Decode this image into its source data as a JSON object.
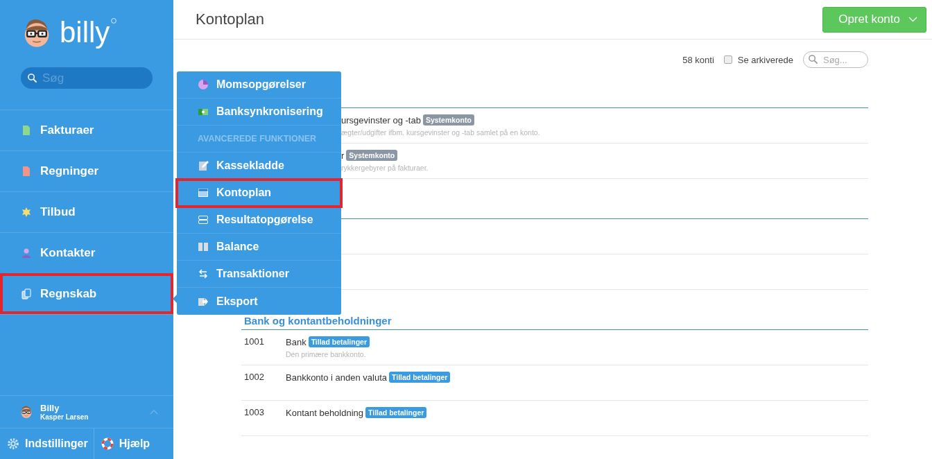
{
  "sidebar": {
    "logo": "billy",
    "search": {
      "placeholder": "Søg"
    },
    "nav": [
      {
        "label": "Fakturaer",
        "kind": "invoice",
        "highlighted": false
      },
      {
        "label": "Regninger",
        "kind": "bill",
        "highlighted": false
      },
      {
        "label": "Tilbud",
        "kind": "star",
        "highlighted": false
      },
      {
        "label": "Kontakter",
        "kind": "person",
        "highlighted": false
      },
      {
        "label": "Regnskab",
        "kind": "pages",
        "highlighted": true
      }
    ],
    "user": {
      "name": "Billy",
      "company": "Kasper Larsen"
    },
    "footer": [
      {
        "label": "Indstillinger",
        "kind": "settings"
      },
      {
        "label": "Hjælp",
        "kind": "help"
      }
    ]
  },
  "header": {
    "title": "Kontoplan",
    "button": "Opret konto"
  },
  "toolbar": {
    "count": "58 konti",
    "archived": {
      "label": "Se arkiverede",
      "checked": false
    },
    "search": {
      "placeholder": "Søg..."
    }
  },
  "popup": {
    "items": [
      {
        "kind": "pie",
        "label": "Momsopgørelser",
        "highlighted": false
      },
      {
        "kind": "money",
        "label": "Banksynkronisering",
        "highlighted": false
      },
      {
        "kind": "header",
        "label": "AVANCEREDE FUNKTIONER"
      },
      {
        "kind": "edit",
        "label": "Kassekladde",
        "highlighted": false
      },
      {
        "kind": "window",
        "label": "Kontoplan",
        "highlighted": true
      },
      {
        "kind": "rows",
        "label": "Resultatopgørelse",
        "highlighted": false
      },
      {
        "kind": "columns",
        "label": "Balance",
        "highlighted": false
      },
      {
        "kind": "swap",
        "label": "Transaktioner",
        "highlighted": false
      },
      {
        "kind": "export",
        "label": "Eksport",
        "highlighted": false
      }
    ]
  },
  "sections": [
    {
      "rows": [
        {
          "kind": "covered",
          "name": "ursgevinster og -tab",
          "badge": {
            "kind": "system",
            "label": "Systemkonto"
          },
          "description": "ægter/udgifter ifbm. kursgevinster og -tab samlet på en konto."
        },
        {
          "kind": "covered",
          "name": "r",
          "badge": {
            "kind": "system",
            "label": "Systemkonto"
          },
          "description": "rykkergebyrer på fakturaer."
        }
      ]
    },
    {
      "rows": [
        {
          "kind": "hidden"
        },
        {
          "kind": "hidden"
        }
      ]
    },
    {
      "heading": "Bank og kontantbeholdninger",
      "rows": [
        {
          "kind": "full",
          "number": "1001",
          "name": "Bank",
          "badge": {
            "kind": "payment",
            "label": "Tillad betalinger"
          },
          "description": "Den primære bankkonto."
        },
        {
          "kind": "full",
          "number": "1002",
          "name": "Bankkonto i anden valuta",
          "badge": {
            "kind": "payment",
            "label": "Tillad betalinger"
          }
        },
        {
          "kind": "full",
          "number": "1003",
          "name": "Kontant beholdning",
          "badge": {
            "kind": "payment",
            "label": "Tillad betalinger"
          }
        }
      ]
    }
  ]
}
